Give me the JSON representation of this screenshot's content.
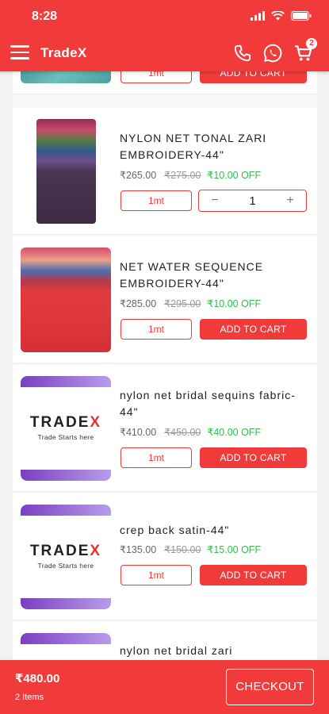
{
  "status_bar": {
    "time": "8:28"
  },
  "app_bar": {
    "title": "TradeX",
    "cart_count": "2"
  },
  "products": [
    {
      "name": "",
      "price": "",
      "mrp": "",
      "off": "",
      "unit": "1mt",
      "action": "ADD TO CART"
    },
    {
      "name": "NYLON NET TONAL ZARI EMBROIDERY-44\"",
      "price": "₹265.00",
      "mrp": "₹275.00",
      "off": "₹10.00 OFF",
      "unit": "1mt",
      "qty": "1",
      "minus": "−",
      "plus": "+"
    },
    {
      "name": "NET WATER SEQUENCE EMBROIDERY-44\"",
      "price": "₹285.00",
      "mrp": "₹295.00",
      "off": "₹10.00 OFF",
      "unit": "1mt",
      "action": "ADD TO CART"
    },
    {
      "name": "nylon net bridal sequins fabric-44\"",
      "price": "₹410.00",
      "mrp": "₹450.00",
      "off": "₹40.00 OFF",
      "unit": "1mt",
      "action": "ADD TO CART"
    },
    {
      "name": "crep back satin-44\"",
      "price": "₹135.00",
      "mrp": "₹150.00",
      "off": "₹15.00 OFF",
      "unit": "1mt",
      "action": "ADD TO CART"
    },
    {
      "name": "nylon net bridal zari"
    }
  ],
  "logo": {
    "word": "TRADE",
    "x": "X",
    "tagline": "Trade Starts here"
  },
  "bottom_bar": {
    "total": "₹480.00",
    "items": "2 Items",
    "checkout": "CHECKOUT"
  }
}
